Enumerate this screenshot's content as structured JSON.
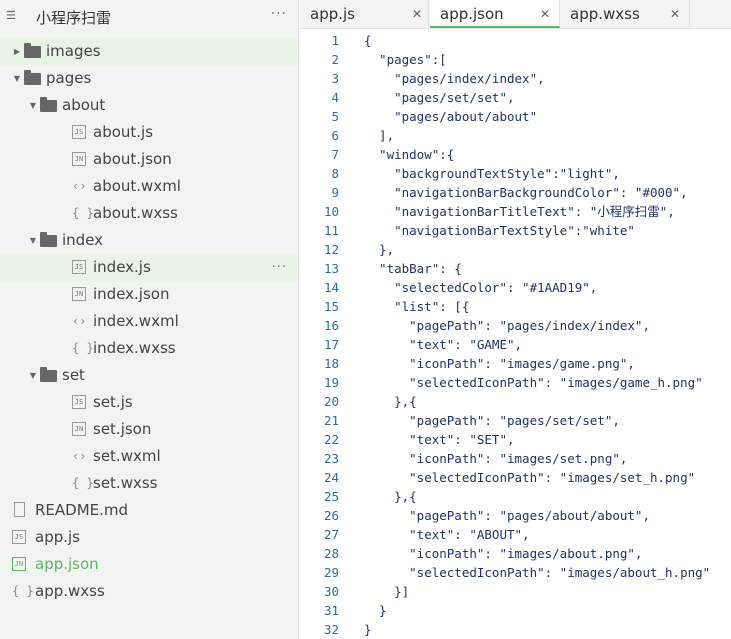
{
  "sidebar": {
    "project_title": "小程序扫雷",
    "more_label": "···",
    "items": [
      {
        "label": "images",
        "type": "folder",
        "expanded": false,
        "depth": 0,
        "selected": true
      },
      {
        "label": "pages",
        "type": "folder",
        "expanded": true,
        "depth": 0
      },
      {
        "label": "about",
        "type": "folder",
        "expanded": true,
        "depth": 1
      },
      {
        "label": "about.js",
        "type": "js",
        "icon_text": "JS",
        "depth": 2
      },
      {
        "label": "about.json",
        "type": "json",
        "icon_text": "JN",
        "depth": 2
      },
      {
        "label": "about.wxml",
        "type": "wxml",
        "icon_text": "‹›",
        "depth": 2
      },
      {
        "label": "about.wxss",
        "type": "wxss",
        "icon_text": "{ }",
        "depth": 2
      },
      {
        "label": "index",
        "type": "folder",
        "expanded": true,
        "depth": 1
      },
      {
        "label": "index.js",
        "type": "js",
        "icon_text": "JS",
        "depth": 2,
        "selected": true,
        "more": "···"
      },
      {
        "label": "index.json",
        "type": "json",
        "icon_text": "JN",
        "depth": 2
      },
      {
        "label": "index.wxml",
        "type": "wxml",
        "icon_text": "‹›",
        "depth": 2
      },
      {
        "label": "index.wxss",
        "type": "wxss",
        "icon_text": "{ }",
        "depth": 2
      },
      {
        "label": "set",
        "type": "folder",
        "expanded": true,
        "depth": 1
      },
      {
        "label": "set.js",
        "type": "js",
        "icon_text": "JS",
        "depth": 2
      },
      {
        "label": "set.json",
        "type": "json",
        "icon_text": "JN",
        "depth": 2
      },
      {
        "label": "set.wxml",
        "type": "wxml",
        "icon_text": "‹›",
        "depth": 2
      },
      {
        "label": "set.wxss",
        "type": "wxss",
        "icon_text": "{ }",
        "depth": 2
      },
      {
        "label": "README.md",
        "type": "doc",
        "depth": 0
      },
      {
        "label": "app.js",
        "type": "js",
        "icon_text": "JS",
        "depth": 0
      },
      {
        "label": "app.json",
        "type": "json",
        "icon_text": "JN",
        "depth": 0,
        "active": true
      },
      {
        "label": "app.wxss",
        "type": "wxss",
        "icon_text": "{ }",
        "depth": 0
      }
    ]
  },
  "editor": {
    "tabs": [
      {
        "label": "app.js",
        "close": "✕",
        "active": false
      },
      {
        "label": "app.json",
        "close": "✕",
        "active": true
      },
      {
        "label": "app.wxss",
        "close": "✕",
        "active": false
      }
    ],
    "lines": [
      "{",
      "  \"pages\":[",
      "    \"pages/index/index\",",
      "    \"pages/set/set\",",
      "    \"pages/about/about\"",
      "  ],",
      "  \"window\":{",
      "    \"backgroundTextStyle\":\"light\",",
      "    \"navigationBarBackgroundColor\": \"#000\",",
      "    \"navigationBarTitleText\": \"小程序扫雷\",",
      "    \"navigationBarTextStyle\":\"white\"",
      "  },",
      "  \"tabBar\": {",
      "    \"selectedColor\": \"#1AAD19\",",
      "    \"list\": [{",
      "      \"pagePath\": \"pages/index/index\",",
      "      \"text\": \"GAME\",",
      "      \"iconPath\": \"images/game.png\",",
      "      \"selectedIconPath\": \"images/game_h.png\"",
      "    },{",
      "      \"pagePath\": \"pages/set/set\",",
      "      \"text\": \"SET\",",
      "      \"iconPath\": \"images/set.png\",",
      "      \"selectedIconPath\": \"images/set_h.png\"",
      "    },{",
      "      \"pagePath\": \"pages/about/about\",",
      "      \"text\": \"ABOUT\",",
      "      \"iconPath\": \"images/about.png\",",
      "      \"selectedIconPath\": \"images/about_h.png\"",
      "    }]",
      "  }",
      "}"
    ]
  },
  "colors": {
    "accent": "#5cb85c",
    "line_number": "#2a6da8",
    "code_text": "#24326b",
    "selected_row": "#e9f3e6"
  }
}
